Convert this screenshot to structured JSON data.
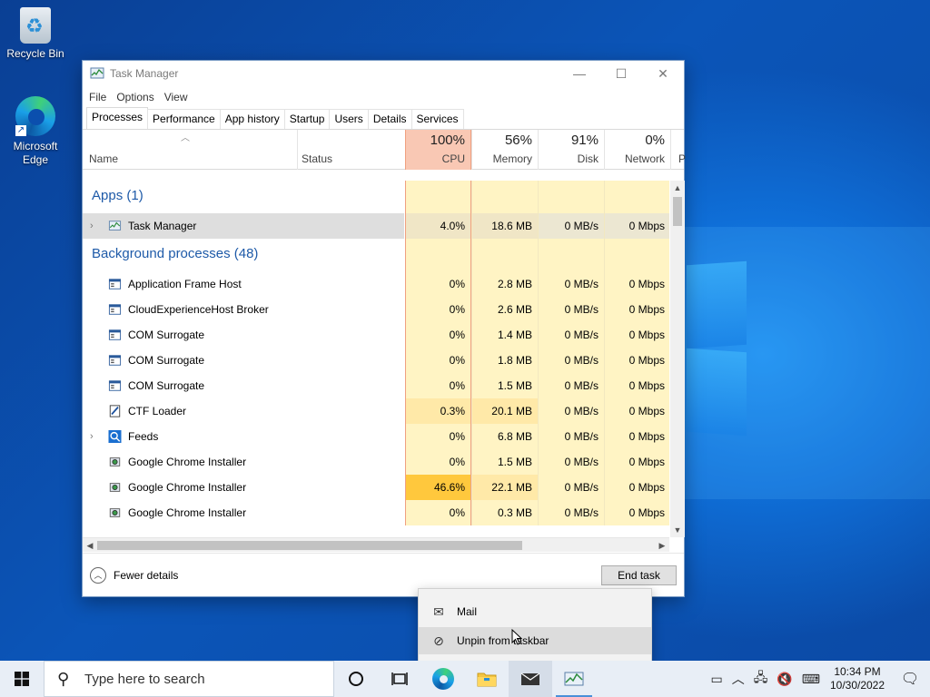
{
  "desktop": {
    "icons": [
      {
        "label": "Recycle Bin"
      },
      {
        "label": "Microsoft Edge"
      }
    ]
  },
  "window": {
    "title": "Task Manager",
    "controls": {
      "minimize": "—",
      "maximize": "☐",
      "close": "✕"
    },
    "menu": [
      "File",
      "Options",
      "View"
    ],
    "tabs": [
      "Processes",
      "Performance",
      "App history",
      "Startup",
      "Users",
      "Details",
      "Services"
    ],
    "active_tab": "Processes",
    "columns": {
      "name": "Name",
      "status": "Status",
      "cpu": {
        "pct": "100%",
        "label": "CPU"
      },
      "memory": {
        "pct": "56%",
        "label": "Memory"
      },
      "disk": {
        "pct": "91%",
        "label": "Disk"
      },
      "network": {
        "pct": "0%",
        "label": "Network"
      },
      "power_partial": "P"
    },
    "groups": {
      "apps": "Apps (1)",
      "background": "Background processes (48)"
    },
    "apps": [
      {
        "name": "Task Manager",
        "cpu": "4.0%",
        "memory": "18.6 MB",
        "disk": "0 MB/s",
        "network": "0 Mbps",
        "expandable": true,
        "icon": "task-manager-icon"
      }
    ],
    "background": [
      {
        "name": "Application Frame Host",
        "cpu": "0%",
        "memory": "2.8 MB",
        "disk": "0 MB/s",
        "network": "0 Mbps",
        "icon": "app-window-icon"
      },
      {
        "name": "CloudExperienceHost Broker",
        "cpu": "0%",
        "memory": "2.6 MB",
        "disk": "0 MB/s",
        "network": "0 Mbps",
        "icon": "app-window-icon"
      },
      {
        "name": "COM Surrogate",
        "cpu": "0%",
        "memory": "1.4 MB",
        "disk": "0 MB/s",
        "network": "0 Mbps",
        "icon": "app-window-icon"
      },
      {
        "name": "COM Surrogate",
        "cpu": "0%",
        "memory": "1.8 MB",
        "disk": "0 MB/s",
        "network": "0 Mbps",
        "icon": "app-window-icon"
      },
      {
        "name": "COM Surrogate",
        "cpu": "0%",
        "memory": "1.5 MB",
        "disk": "0 MB/s",
        "network": "0 Mbps",
        "icon": "app-window-icon"
      },
      {
        "name": "CTF Loader",
        "cpu": "0.3%",
        "memory": "20.1 MB",
        "disk": "0 MB/s",
        "network": "0 Mbps",
        "icon": "ctf-loader-icon"
      },
      {
        "name": "Feeds",
        "cpu": "0%",
        "memory": "6.8 MB",
        "disk": "0 MB/s",
        "network": "0 Mbps",
        "icon": "feeds-icon",
        "expandable": true
      },
      {
        "name": "Google Chrome Installer",
        "cpu": "0%",
        "memory": "1.5 MB",
        "disk": "0 MB/s",
        "network": "0 Mbps",
        "icon": "installer-icon"
      },
      {
        "name": "Google Chrome Installer",
        "cpu": "46.6%",
        "memory": "22.1 MB",
        "disk": "0 MB/s",
        "network": "0 Mbps",
        "icon": "installer-icon",
        "hot": true
      },
      {
        "name": "Google Chrome Installer",
        "cpu": "0%",
        "memory": "0.3 MB",
        "disk": "0 MB/s",
        "network": "0 Mbps",
        "icon": "installer-icon"
      }
    ],
    "footer": {
      "fewer_details": "Fewer details",
      "end_task": "End task"
    }
  },
  "jump_menu": {
    "items": [
      {
        "label": "Mail",
        "icon": "mail-icon"
      },
      {
        "label": "Unpin from taskbar",
        "icon": "unpin-icon"
      }
    ]
  },
  "taskbar": {
    "search_placeholder": "Type here to search",
    "clock_time": "10:34 PM",
    "clock_date": "10/30/2022"
  },
  "colors": {
    "cpu_header": "#f9c8b4",
    "heat_low": "#fff4c4",
    "heat_mid": "#ffe9a8",
    "heat_hot": "#ffc83d",
    "group_text": "#1e5aa8"
  }
}
